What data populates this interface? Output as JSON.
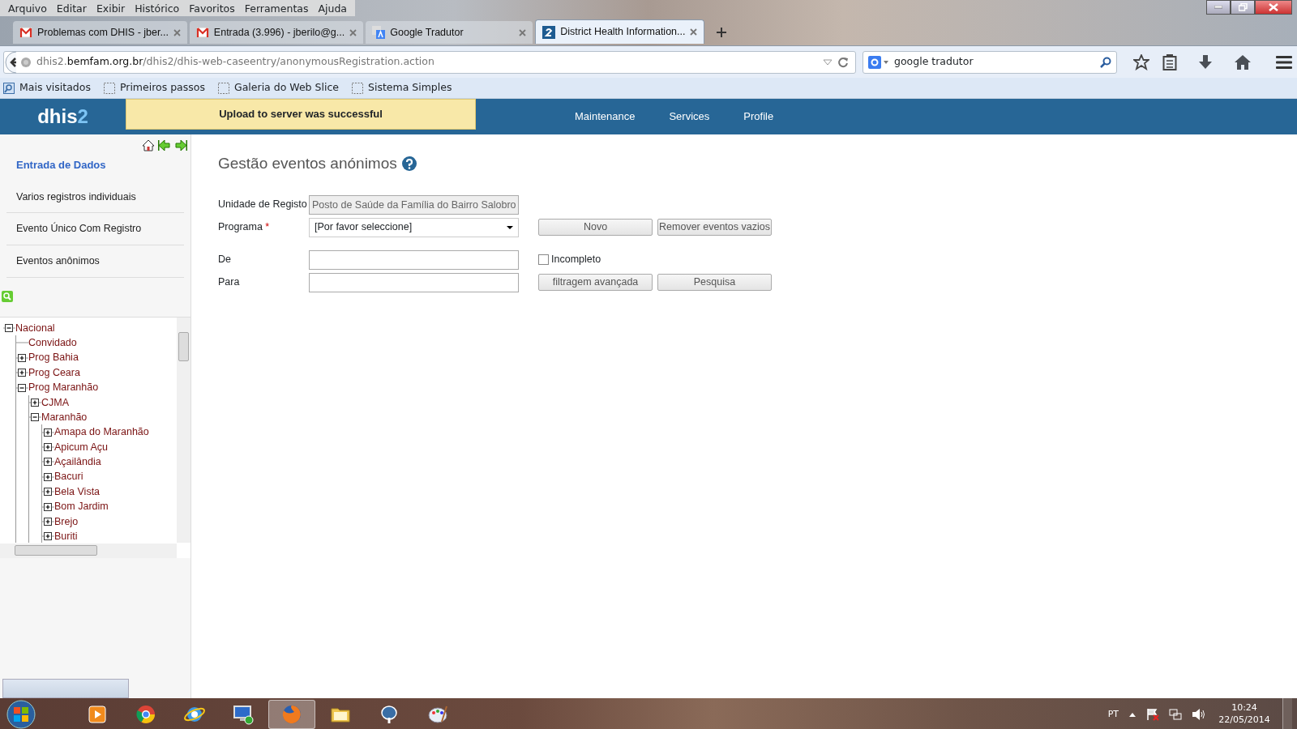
{
  "menu_bar": [
    "Arquivo",
    "Editar",
    "Exibir",
    "Histórico",
    "Favoritos",
    "Ferramentas",
    "Ajuda"
  ],
  "tabs": [
    {
      "title": "Problemas com DHIS - jber...",
      "kind": "mail",
      "selected": false
    },
    {
      "title": "Entrada (3.996) - jberilo@g...",
      "kind": "mail",
      "selected": false
    },
    {
      "title": "Google Tradutor",
      "kind": "translate",
      "selected": false
    },
    {
      "title": "District Health Information...",
      "kind": "dhis",
      "selected": true
    }
  ],
  "address_bar": {
    "url_prefix": "dhis2.",
    "url_domain": "bemfam.org.br",
    "url_path": "/dhis2/dhis-web-caseentry/anonymousRegistration.action"
  },
  "search_box": {
    "value": "google tradutor"
  },
  "bookmarks": [
    {
      "label": "Mais visitados",
      "kind": "smart"
    },
    {
      "label": "Primeiros passos",
      "kind": "page"
    },
    {
      "label": "Galeria do Web Slice",
      "kind": "page"
    },
    {
      "label": "Sistema Simples",
      "kind": "page"
    }
  ],
  "app_header": {
    "logo": "dhis2",
    "notice": "Upload to server was successful",
    "nav": [
      "Maintenance",
      "Services",
      "Profile"
    ]
  },
  "sidebar": {
    "title": "Entrada de Dados",
    "items": [
      "Varios registros individuais",
      "Evento Único Com Registro",
      "Eventos anônimos"
    ]
  },
  "tree": [
    {
      "label": "Nacional",
      "kind": "folder",
      "expanded": true,
      "children": [
        {
          "label": "Convidado",
          "kind": "leaf"
        },
        {
          "label": "Prog Bahia",
          "kind": "folder",
          "expanded": false
        },
        {
          "label": "Prog Ceara",
          "kind": "folder",
          "expanded": false
        },
        {
          "label": "Prog Maranhão",
          "kind": "folder",
          "expanded": true,
          "children": [
            {
              "label": "CJMA",
              "kind": "folder",
              "expanded": false
            },
            {
              "label": "Maranhão",
              "kind": "folder",
              "expanded": true,
              "children": [
                {
                  "label": "Amapa do Maranhão",
                  "kind": "folder",
                  "expanded": false
                },
                {
                  "label": "Apicum Açu",
                  "kind": "folder",
                  "expanded": false
                },
                {
                  "label": "Açailândia",
                  "kind": "folder",
                  "expanded": false
                },
                {
                  "label": "Bacuri",
                  "kind": "folder",
                  "expanded": false
                },
                {
                  "label": "Bela Vista",
                  "kind": "folder",
                  "expanded": false
                },
                {
                  "label": "Bom Jardim",
                  "kind": "folder",
                  "expanded": false
                },
                {
                  "label": "Brejo",
                  "kind": "folder",
                  "expanded": false
                },
                {
                  "label": "Buriti",
                  "kind": "folder",
                  "expanded": false
                }
              ]
            }
          ]
        }
      ]
    }
  ],
  "form": {
    "title": "Gestão eventos anónimos",
    "rows": [
      {
        "label": "Unidade de Registo",
        "field": {
          "kind": "text",
          "value": "Posto de Saúde da Família do Bairro Salobro",
          "disabled": true
        }
      },
      {
        "label": "Programa",
        "required_mark": "*",
        "field": {
          "kind": "select",
          "value": "[Por favor seleccione]",
          "disabled": false
        },
        "actions": [
          {
            "kind": "button",
            "label": "Novo"
          },
          {
            "kind": "button",
            "label": "Remover eventos vazios"
          }
        ]
      },
      {
        "label": "De",
        "field": {
          "kind": "text",
          "disabled": false
        },
        "actions": [
          {
            "kind": "checkbox",
            "label": "Incompleto",
            "checked": false
          }
        ]
      },
      {
        "label": "Para",
        "field": {
          "kind": "text",
          "disabled": false
        },
        "actions": [
          {
            "kind": "button",
            "label": "filtragem avançada"
          },
          {
            "kind": "button",
            "label": "Pesquisa"
          }
        ]
      }
    ]
  },
  "taskbar": {
    "apps": [
      {
        "kind": "media",
        "selected": false
      },
      {
        "kind": "chrome",
        "selected": false
      },
      {
        "kind": "ie",
        "selected": false
      },
      {
        "kind": "remote",
        "selected": false
      },
      {
        "kind": "firefox",
        "selected": true
      },
      {
        "kind": "folder",
        "selected": false
      },
      {
        "kind": "elephant",
        "selected": false
      },
      {
        "kind": "paint",
        "selected": false
      }
    ],
    "language": "PT",
    "time": "10:24",
    "date": "22/05/2014"
  }
}
